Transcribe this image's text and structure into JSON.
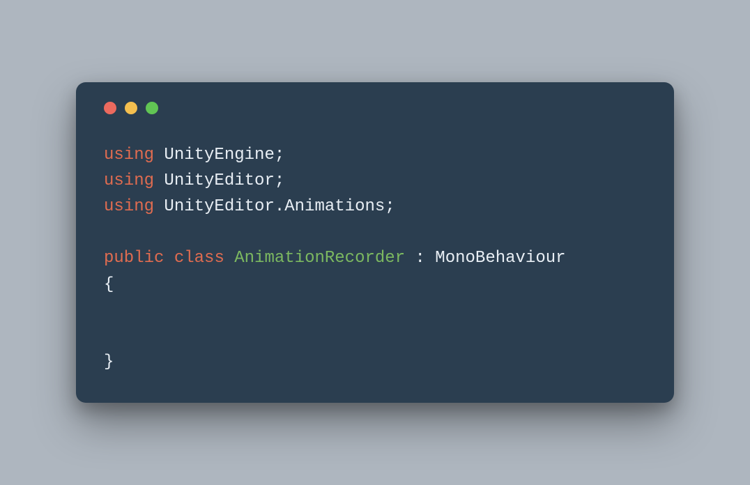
{
  "colors": {
    "background": "#aeb6bf",
    "window": "#2b3e50",
    "red": "#ec6a5e",
    "yellow": "#f4bf4f",
    "green": "#61c554",
    "keyword": "#e06c50",
    "classname": "#7cb860",
    "text": "#e8eef4"
  },
  "code": {
    "line1": {
      "kw": "using",
      "rest": " UnityEngine;"
    },
    "line2": {
      "kw": "using",
      "rest": " UnityEditor;"
    },
    "line3": {
      "kw": "using",
      "rest": " UnityEditor.Animations;"
    },
    "line4": "",
    "line5": {
      "kw1": "public",
      "sp1": " ",
      "kw2": "class",
      "sp2": " ",
      "cls": "AnimationRecorder",
      "rest": " : MonoBehaviour"
    },
    "line6": "{",
    "line7": "",
    "line8": "",
    "line9": "}"
  }
}
